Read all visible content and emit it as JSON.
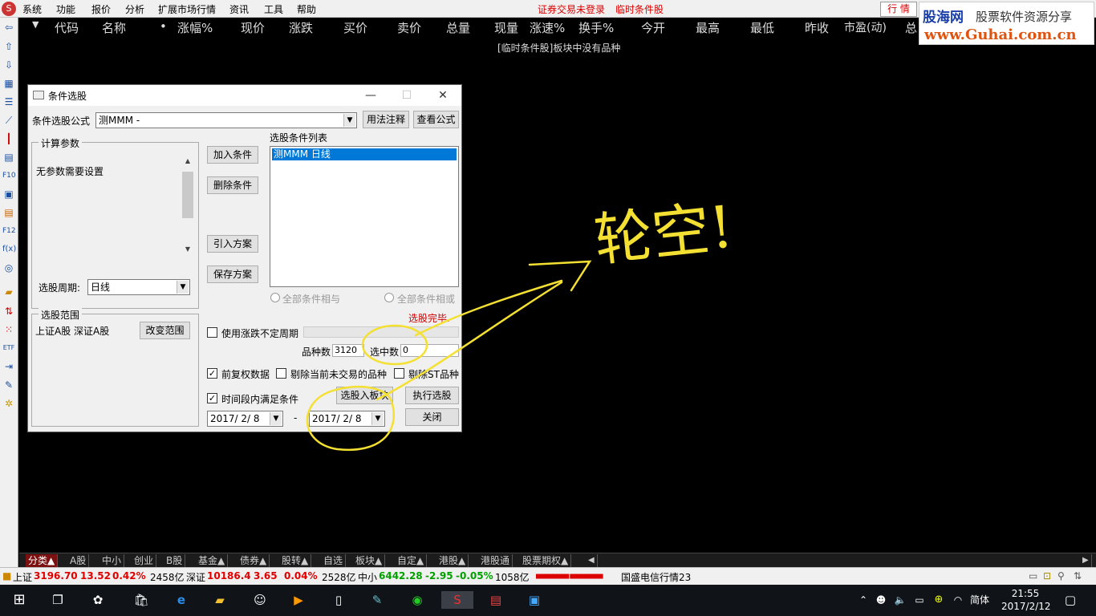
{
  "menu": {
    "items": [
      "系统",
      "功能",
      "报价",
      "分析",
      "扩展市场行情",
      "资讯",
      "工具",
      "帮助"
    ],
    "status1": "证券交易未登录",
    "status2": "临时条件股",
    "hq_button": "行 情"
  },
  "watermark": {
    "line1": "股海网",
    "line2": "股票软件资源分享",
    "line3": "www.Guhai.com.cn"
  },
  "columns": [
    "代码",
    "名称",
    "•",
    "涨幅%",
    "现价",
    "涨跌",
    "买价",
    "卖价",
    "总量",
    "现量",
    "涨速%",
    "换手%",
    "今开",
    "最高",
    "最低",
    "昨收",
    "市盈(动)",
    "总"
  ],
  "empty_message": "[临时条件股]板块中没有品种",
  "dialog": {
    "title": "条件选股",
    "formula_label": "条件选股公式",
    "formula_value": "测MMM        -",
    "btn_usage": "用法注释",
    "btn_view": "查看公式",
    "calc_group": "计算参数",
    "no_params": "无参数需要设置",
    "period_label": "选股周期:",
    "period_value": "日线",
    "range_group": "选股范围",
    "range_value": "上证A股 深证A股",
    "btn_change_range": "改变范围",
    "btn_add": "加入条件",
    "btn_delete": "删除条件",
    "btn_import": "引入方案",
    "btn_save": "保存方案",
    "list_label": "选股条件列表",
    "list_items": [
      "测MMM  日线"
    ],
    "radio_and": "全部条件相与",
    "radio_or": "全部条件相或",
    "done_text": "选股完毕.",
    "chk_uncertain": "使用涨跌不定周期",
    "count_label": "品种数",
    "count_value": "3120",
    "selected_label": "选中数",
    "selected_value": "0",
    "chk_adjust": "前复权数据",
    "chk_exclude": "剔除当前未交易的品种",
    "chk_st": "剔除ST品种",
    "chk_period": "时间段内满足条件",
    "btn_to_block": "选股入板块",
    "btn_execute": "执行选股",
    "btn_close": "关闭",
    "date_from": "2017/ 2/ 8",
    "date_to": "2017/ 2/ 8",
    "date_sep": "-"
  },
  "annotation": "轮空!",
  "bottom_tabs": [
    "分类▲",
    "A股",
    "中小",
    "创业",
    "B股",
    "基金▲",
    "债券▲",
    "股转▲",
    "自选",
    "板块▲",
    "自定▲",
    "港股▲",
    "港股通",
    "股票期权▲"
  ],
  "statusbar": {
    "sh_label": "上证",
    "sh_value": "3196.70",
    "sh_chg": "13.52",
    "sh_pct": "0.42%",
    "sh_vol": "2458亿",
    "sz_label": "深证",
    "sz_value": "10186.4",
    "sz_chg": "3.65",
    "sz_pct": "0.04%",
    "sz_vol": "2528亿",
    "zx_label": "中小",
    "zx_value": "6442.28",
    "zx_chg": "-2.95",
    "zx_pct": "-0.05%",
    "zx_vol": "1058亿",
    "news": "国盛电信行情23"
  },
  "taskbar": {
    "lang": "简体",
    "time": "21:55",
    "date": "2017/2/12"
  },
  "colors": {
    "up": "#e00000",
    "down": "#00a000",
    "annotation": "#f4e033",
    "selection": "#0078d7"
  }
}
